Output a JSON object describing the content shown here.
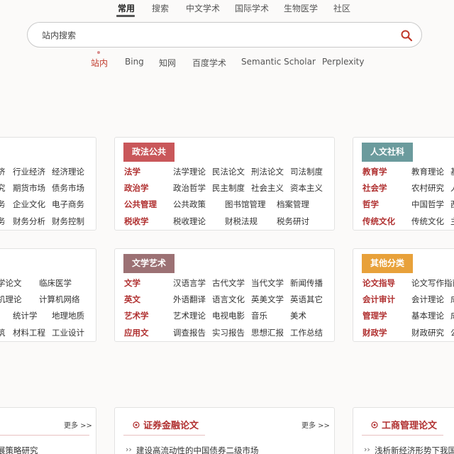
{
  "top_nav": [
    "常用",
    "搜索",
    "中文学术",
    "国际学术",
    "生物医学",
    "社区"
  ],
  "search": {
    "placeholder": "站内搜索"
  },
  "engines": [
    "站内",
    "Bing",
    "知网",
    "百度学术",
    "Semantic Scholar",
    "Perplexity"
  ],
  "colors": {
    "politics": "#c9575a",
    "humanities": "#6b9b9d",
    "literature": "#9c7174",
    "other": "#e8a13a",
    "accent": "#b03030"
  },
  "panel_left_top": [
    [
      "济",
      "行业经济",
      "经济理论"
    ],
    [
      "究",
      "期货市场",
      "债务市场"
    ],
    [
      "务",
      "企业文化",
      "电子商务"
    ],
    [
      "务",
      "财务分析",
      "财务控制"
    ]
  ],
  "panel_left_bottom": [
    [
      "学论文",
      "临床医学"
    ],
    [
      "机理论",
      "计算机网络"
    ],
    [
      "",
      "统计学",
      "地理地质"
    ],
    [
      "筑",
      "材料工程",
      "工业设计"
    ]
  ],
  "politics": {
    "title": "政法公共",
    "rows": [
      [
        "法学",
        "法学理论",
        "民法论文",
        "刑法论文",
        "司法制度"
      ],
      [
        "政治学",
        "政治哲学",
        "民主制度",
        "社会主义",
        "资本主义"
      ],
      [
        "公共管理",
        "公共政策",
        "图书馆管理",
        "档案管理"
      ],
      [
        "税收学",
        "税收理论",
        "财税法规",
        "税务研讨"
      ]
    ]
  },
  "humanities": {
    "title": "人文社科",
    "rows": [
      [
        "教育学",
        "教育理论",
        "基"
      ],
      [
        "社会学",
        "农村研究",
        "人"
      ],
      [
        "哲学",
        "中国哲学",
        "西"
      ],
      [
        "传统文化",
        "传统文化",
        "主"
      ]
    ]
  },
  "literature": {
    "title": "文学艺术",
    "rows": [
      [
        "文学",
        "汉语言学",
        "古代文学",
        "当代文学",
        "新闻传播"
      ],
      [
        "英文",
        "外语翻译",
        "语言文化",
        "英美文学",
        "英语其它"
      ],
      [
        "艺术学",
        "艺术理论",
        "电视电影",
        "音乐",
        "美术"
      ],
      [
        "应用文",
        "调查报告",
        "实习报告",
        "思想汇报",
        "工作总结"
      ]
    ]
  },
  "other": {
    "title": "其他分类",
    "rows": [
      [
        "论文指导",
        "论文写作指南"
      ],
      [
        "会计审计",
        "会计理论",
        "成"
      ],
      [
        "管理学",
        "基本理论",
        "成"
      ],
      [
        "财政学",
        "财政研究",
        "公"
      ]
    ]
  },
  "news": [
    {
      "title": "",
      "more": "更多 >>",
      "item": "展策略研究"
    },
    {
      "title": "证券金融论文",
      "more": "更多 >>",
      "item": "建设高流动性的中国债券二级市场"
    },
    {
      "title": "工商管理论文",
      "more": "",
      "item": "浅析新经济形势下我国"
    }
  ]
}
